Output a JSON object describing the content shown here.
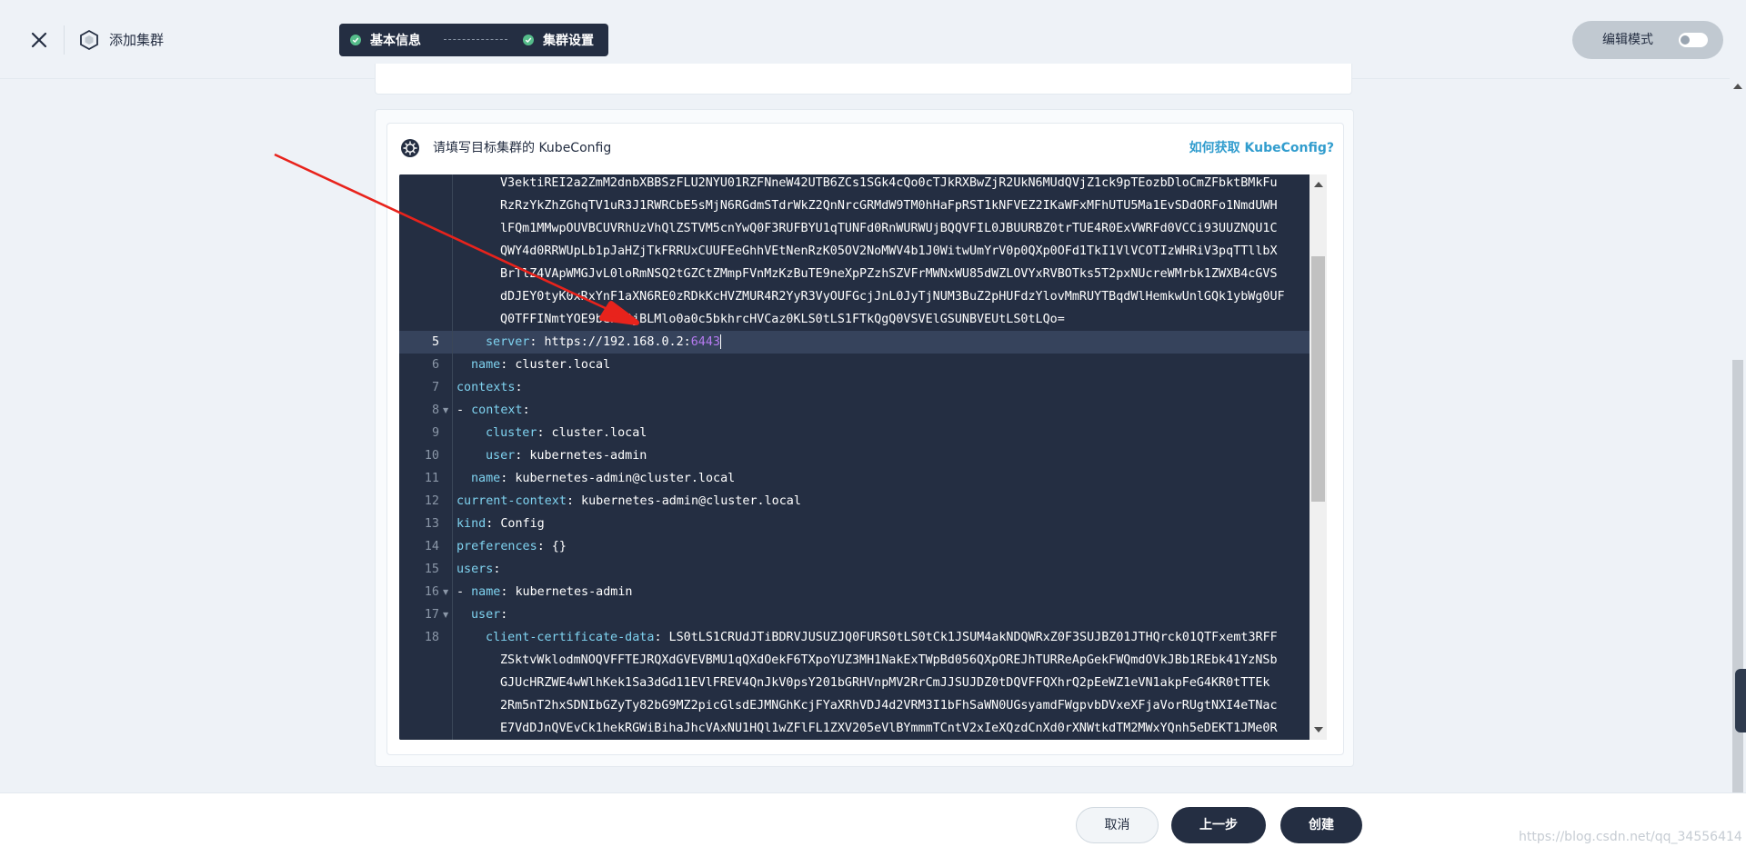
{
  "header": {
    "close_icon": "close-icon",
    "title": "添加集群",
    "title_icon": "cluster-icon",
    "steps": [
      {
        "label": "基本信息",
        "status": "done"
      },
      {
        "label": "集群设置",
        "status": "done"
      }
    ],
    "mode_label": "编辑模式",
    "mode_toggle_on": false
  },
  "kubeconfig": {
    "title": "请填写目标集群的 KubeConfig",
    "help_link": "如何获取 KubeConfig?"
  },
  "editor": {
    "wrapped_top": [
      "V3ektiREI2a2ZmM2dnbXBBSzFLU2NYU01RZFNneW42UTB6ZCs1SGk4cQo0cTJkRXBwZjR2UkN6MUdQVjZ1ck9pTEozbDloCmZFbktBMkFu",
      "RzRzYkZhZGhqTV1uR3J1RWRCbE5sMjN6RGdmSTdrWkZ2QnNrcGRMdW9TM0hHaFpRST1kNFVEZ2IKaWFxMFhUTU5Ma1EvSDdORFo1NmdUWH",
      "lFQm1MMwpOUVBCUVRhUzVhQlZSTVM5cnYwQ0F3RUFBYU1qTUNFd0RnWURWUjBQQVFIL0JBUURBZ0trTUE4R0ExVWRFd0VCCi93UUZNQU1C",
      "QWY4d0RRWUpLb1pJaHZjTkFRRUxCUUFEeGhhVEtNenRzK05OV2NoMWV4b1J0WitwUmYrV0p0QXp0OFd1TkI1VlVCOTIzWHRiV3pqTTllbX",
      "BrTlZ4VApWMGJvL0loRmNSQ2tGZCtZMmpFVnMzKzBuTE9neXpPZzhSZVFrMWNxWU85dWZLOVYxRVBOTks5T2pxNUcreWMrbk1ZWXB4cGVS",
      "dDJEY0tyK0xRxYnF1aXN6RE0zRDkKcHVZMUR4R2YyR3VyOUFGcjJnL0JyTjNUM3BuZ2pHUFdzYlovMmRUYTBqdWlHemkwUnlGQk1ybWg0UF",
      "Q0TFFINmtYOE9beWtQjBLMlo0a0c5bkhrcHVCaz0KLS0tLS1FTkQgQ0VSVElGSUNBVEUtLS0tLQo="
    ],
    "lines": [
      {
        "no": "5",
        "parts": [
          [
            "k",
            "server"
          ],
          [
            "v",
            ": https://192.168.0.2:"
          ],
          [
            "n",
            "6443"
          ]
        ],
        "indent": 2,
        "active": true
      },
      {
        "no": "6",
        "parts": [
          [
            "k",
            "name"
          ],
          [
            "v",
            ": cluster.local"
          ]
        ],
        "indent": 1
      },
      {
        "no": "7",
        "parts": [
          [
            "k",
            "contexts"
          ],
          [
            "v",
            ":"
          ]
        ],
        "indent": 0
      },
      {
        "no": "8",
        "fold": true,
        "parts": [
          [
            "v",
            "- "
          ],
          [
            "k",
            "context"
          ],
          [
            "v",
            ":"
          ]
        ],
        "indent": 0
      },
      {
        "no": "9",
        "parts": [
          [
            "k",
            "cluster"
          ],
          [
            "v",
            ": cluster.local"
          ]
        ],
        "indent": 2
      },
      {
        "no": "10",
        "parts": [
          [
            "k",
            "user"
          ],
          [
            "v",
            ": kubernetes-admin"
          ]
        ],
        "indent": 2
      },
      {
        "no": "11",
        "parts": [
          [
            "k",
            "name"
          ],
          [
            "v",
            ": kubernetes-admin@cluster.local"
          ]
        ],
        "indent": 1
      },
      {
        "no": "12",
        "parts": [
          [
            "k",
            "current-context"
          ],
          [
            "v",
            ": kubernetes-admin@cluster.local"
          ]
        ],
        "indent": 0
      },
      {
        "no": "13",
        "parts": [
          [
            "k",
            "kind"
          ],
          [
            "v",
            ": Config"
          ]
        ],
        "indent": 0
      },
      {
        "no": "14",
        "parts": [
          [
            "k",
            "preferences"
          ],
          [
            "v",
            ": {}"
          ]
        ],
        "indent": 0
      },
      {
        "no": "15",
        "parts": [
          [
            "k",
            "users"
          ],
          [
            "v",
            ":"
          ]
        ],
        "indent": 0
      },
      {
        "no": "16",
        "fold": true,
        "parts": [
          [
            "v",
            "- "
          ],
          [
            "k",
            "name"
          ],
          [
            "v",
            ": kubernetes-admin"
          ]
        ],
        "indent": 0
      },
      {
        "no": "17",
        "fold": true,
        "parts": [
          [
            "k",
            "user"
          ],
          [
            "v",
            ":"
          ]
        ],
        "indent": 1
      },
      {
        "no": "18",
        "parts": [
          [
            "k",
            "client-certificate-data"
          ],
          [
            "v",
            ": LS0tLS1CRUdJTiBDRVJUSUZJQ0FURS0tLS0tCk1JSUM4akNDQWRxZ0F3SUJBZ01JTHQrck01QTFxemt3RFF"
          ]
        ],
        "indent": 2
      }
    ],
    "wrapped_bottom": [
      "ZSktvWklodmNOQVFFTEJRQXdGVEVBMU1qQXdOekF6TXpoYUZ3MH1NakExTWpBd056QXpOREJhTURReApGekFWQmdOVkJBb1REbk41YzNSb",
      "GJUcHRZWE4wWlhKek1Sa3dGd11EVlFREV4QnJkV0psY201bGRHVnpMV2RrCmJJSUJDZ0tDQVFFQXhrQ2pEeWZ1eVN1akpFeG4KR0tTTEk",
      "2Rm5nT2hxSDNIbGZyTy82bG9MZ2picGlsdEJMNGhKcjFYaXRhVDJ4d2VRM3I1bFhSaWN0UGsyamdFWgpvbDVxeXFjaVorRUgtNXI4eTNac",
      "E7VdDJnQVEvCk1hekRGWiBihaJhcVAxNU1HQl1wZFlFL1ZXV205eVlBYmmmTCntV2xIeXQzdCnXd0rXNWtkdTM2MWxYQnh5eDEKT1JMe0R"
    ]
  },
  "footer": {
    "cancel": "取消",
    "prev": "上一步",
    "create": "创建",
    "watermark": "https://blog.csdn.net/qq_34556414"
  },
  "colors": {
    "dark": "#242e42",
    "accent": "#329dce",
    "success": "#55bc8a",
    "annotation_arrow": "#e8231c"
  }
}
